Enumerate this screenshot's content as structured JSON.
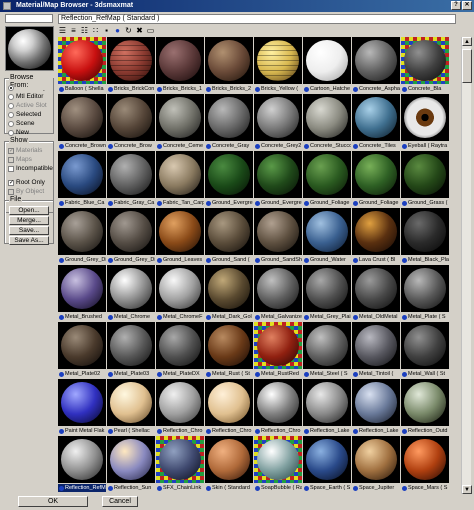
{
  "window": {
    "title": "Material/Map Browser - 3dsmaxmat"
  },
  "header": {
    "current": "Reflection_RefMap ( Standard )"
  },
  "toolbar": {
    "icons": [
      "list-icon",
      "list-small-icon",
      "list-large-icon",
      "small-icons-icon",
      "large-icons-icon",
      "globe-icon",
      "update-scene-icon",
      "delete-icon",
      "clear-icon"
    ]
  },
  "browse_from": {
    "title": "Browse From:",
    "options": [
      {
        "label": "Mtl Library",
        "selected": true,
        "enabled": true
      },
      {
        "label": "Mtl Editor",
        "selected": false,
        "enabled": true
      },
      {
        "label": "Active Slot",
        "selected": false,
        "enabled": false
      },
      {
        "label": "Selected",
        "selected": false,
        "enabled": true
      },
      {
        "label": "Scene",
        "selected": false,
        "enabled": true
      },
      {
        "label": "New",
        "selected": false,
        "enabled": true
      }
    ]
  },
  "show": {
    "title": "Show",
    "options": [
      {
        "label": "Materials",
        "checked": true,
        "enabled": false
      },
      {
        "label": "Maps",
        "checked": false,
        "enabled": false
      },
      {
        "label": "Incompatible",
        "checked": false,
        "enabled": true
      }
    ],
    "root_only": "Root Only",
    "by_object": "By Object"
  },
  "file": {
    "title": "File",
    "buttons": [
      "Open...",
      "Merge...",
      "Save...",
      "Save As..."
    ]
  },
  "footer": {
    "ok": "OK",
    "cancel": "Cancel"
  },
  "materials": [
    {
      "label": "Balloon  ( Shella",
      "colors": [
        "#ff6a5a",
        "#c81010",
        "#300000"
      ],
      "special": "check",
      "selected": false
    },
    {
      "label": "Bricks_BrickCon",
      "colors": [
        "#d07060",
        "#8a3a30",
        "#2a0c08"
      ],
      "special": "bricks",
      "selected": false
    },
    {
      "label": "Bricks_Bricks_1",
      "colors": [
        "#9a7070",
        "#5a3838",
        "#150808"
      ],
      "special": "",
      "selected": false
    },
    {
      "label": "Bricks_Bricks_2",
      "colors": [
        "#b09070",
        "#6a4a38",
        "#1a1008"
      ],
      "special": "",
      "selected": false
    },
    {
      "label": "Bricks_Yellow  (",
      "colors": [
        "#fff0a0",
        "#d8b850",
        "#4a3010"
      ],
      "special": "bricks",
      "selected": false
    },
    {
      "label": "Cartoon_Hatche",
      "colors": [
        "#ffffff",
        "#eeeeee",
        "#9a9a9a"
      ],
      "special": "",
      "selected": false
    },
    {
      "label": "Concrete_Aspha",
      "colors": [
        "#b8b8b8",
        "#606060",
        "#151515"
      ],
      "special": "",
      "selected": false
    },
    {
      "label": "Concrete_Bla",
      "colors": [
        "#909090",
        "#404040",
        "#080808"
      ],
      "special": "check",
      "selected": false
    },
    {
      "label": "Concrete_Brown",
      "colors": [
        "#a09080",
        "#5a4a40",
        "#100c08"
      ],
      "special": "",
      "selected": false
    },
    {
      "label": "Concrete_Brow",
      "colors": [
        "#9a8a78",
        "#554538",
        "#100c08"
      ],
      "special": "",
      "selected": false
    },
    {
      "label": "Concrete_Ceme",
      "colors": [
        "#c0c0b8",
        "#707068",
        "#181818"
      ],
      "special": "",
      "selected": false
    },
    {
      "label": "Concrete_Gray",
      "colors": [
        "#b8b8b8",
        "#686868",
        "#151515"
      ],
      "special": "",
      "selected": false
    },
    {
      "label": "Concrete_Grey2",
      "colors": [
        "#d0d0d0",
        "#787878",
        "#181818"
      ],
      "special": "",
      "selected": false
    },
    {
      "label": "Concrete_Stucco",
      "colors": [
        "#d8d8d0",
        "#8a8a80",
        "#1a1a18"
      ],
      "special": "",
      "selected": false
    },
    {
      "label": "Concrete_Tiles",
      "colors": [
        "#a8d0e8",
        "#407090",
        "#081520"
      ],
      "special": "",
      "selected": false
    },
    {
      "label": "Eyeball  ( Raytra",
      "colors": [
        "#e8e8e8",
        "#8a5a30",
        "#180c04"
      ],
      "special": "eye",
      "selected": false
    },
    {
      "label": "Fabric_Blue_Ca",
      "colors": [
        "#7a9ad0",
        "#2a4a80",
        "#050a18"
      ],
      "special": "",
      "selected": false
    },
    {
      "label": "Fabric_Gray_Ca",
      "colors": [
        "#b0b0b0",
        "#606060",
        "#101010"
      ],
      "special": "",
      "selected": false
    },
    {
      "label": "Fabric_Tan_Carp",
      "colors": [
        "#d8c8b0",
        "#8a7a60",
        "#181410"
      ],
      "special": "",
      "selected": false
    },
    {
      "label": "Ground_Evergre",
      "colors": [
        "#4a8a40",
        "#1a4a18",
        "#050e04"
      ],
      "special": "",
      "selected": false
    },
    {
      "label": "Ground_Evergre",
      "colors": [
        "#5a9a48",
        "#204a1a",
        "#050e04"
      ],
      "special": "",
      "selected": false
    },
    {
      "label": "Ground_Foliage",
      "colors": [
        "#6aa050",
        "#2a5a20",
        "#081405"
      ],
      "special": "",
      "selected": false
    },
    {
      "label": "Ground_Foliage",
      "colors": [
        "#78b058",
        "#2e6024",
        "#081405"
      ],
      "special": "",
      "selected": false
    },
    {
      "label": "Ground_Grass  (",
      "colors": [
        "#5a8a40",
        "#244818",
        "#060e04"
      ],
      "special": "",
      "selected": false
    },
    {
      "label": "Ground_Grey_Di",
      "colors": [
        "#a8a098",
        "#5a5248",
        "#100e0c"
      ],
      "special": "",
      "selected": false
    },
    {
      "label": "Ground_Grey_Di",
      "colors": [
        "#a09890",
        "#544c44",
        "#100e0c"
      ],
      "special": "",
      "selected": false
    },
    {
      "label": "Ground_Leaves",
      "colors": [
        "#e0a060",
        "#8a4a18",
        "#1a0c04"
      ],
      "special": "",
      "selected": false
    },
    {
      "label": "Ground_Sand  (",
      "colors": [
        "#a89880",
        "#5a4c3a",
        "#100c08"
      ],
      "special": "",
      "selected": false
    },
    {
      "label": "Ground_SandSh",
      "colors": [
        "#b0a090",
        "#5e5040",
        "#100c08"
      ],
      "special": "",
      "selected": false
    },
    {
      "label": "Ground_Water",
      "colors": [
        "#a0c0e0",
        "#3a6090",
        "#081428"
      ],
      "special": "",
      "selected": false
    },
    {
      "label": "Lava Crust  ( Bl",
      "colors": [
        "#e0a040",
        "#5a3010",
        "#100604"
      ],
      "special": "",
      "selected": false
    },
    {
      "label": "Metal_Black_Pla",
      "colors": [
        "#6a6a6a",
        "#2a2a2a",
        "#050505"
      ],
      "special": "",
      "selected": false
    },
    {
      "label": "Metal_Brushed",
      "colors": [
        "#c8c0e0",
        "#5a4a8a",
        "#0c0818"
      ],
      "special": "",
      "selected": false
    },
    {
      "label": "Metal_Chrome",
      "colors": [
        "#ffffff",
        "#909090",
        "#202020"
      ],
      "special": "",
      "selected": false
    },
    {
      "label": "Metal_ChromeF",
      "colors": [
        "#f8f8f8",
        "#a0a0a0",
        "#282828"
      ],
      "special": "",
      "selected": false
    },
    {
      "label": "Metal_Dark_Gol",
      "colors": [
        "#c0a878",
        "#5a4a30",
        "#100c06"
      ],
      "special": "",
      "selected": false
    },
    {
      "label": "Metal_Galvanize",
      "colors": [
        "#c0c0c0",
        "#606060",
        "#101010"
      ],
      "special": "",
      "selected": false
    },
    {
      "label": "Metal_Grey_Plai",
      "colors": [
        "#a8a8a8",
        "#505050",
        "#0a0a0a"
      ],
      "special": "",
      "selected": false
    },
    {
      "label": "Metal_OldMetal",
      "colors": [
        "#9a9a9a",
        "#484848",
        "#0a0a0a"
      ],
      "special": "",
      "selected": false
    },
    {
      "label": "Metal_Plate  ( S",
      "colors": [
        "#b8b8b8",
        "#585858",
        "#0c0c0c"
      ],
      "special": "",
      "selected": false
    },
    {
      "label": "Metal_Plate02",
      "colors": [
        "#9a8a78",
        "#4a3a2c",
        "#0c0806"
      ],
      "special": "",
      "selected": false
    },
    {
      "label": "Metal_Plate03",
      "colors": [
        "#b0b0b0",
        "#585858",
        "#0c0c0c"
      ],
      "special": "",
      "selected": false
    },
    {
      "label": "Metal_PlateDX",
      "colors": [
        "#a8a8a8",
        "#505050",
        "#0a0a0a"
      ],
      "special": "",
      "selected": false
    },
    {
      "label": "Metal_Rust  ( St",
      "colors": [
        "#b88a60",
        "#6a3a18",
        "#140804"
      ],
      "special": "",
      "selected": false
    },
    {
      "label": "Metal_RustRed",
      "colors": [
        "#e08060",
        "#902010",
        "#200404"
      ],
      "special": "check",
      "selected": false
    },
    {
      "label": "Metal_Steel  ( S",
      "colors": [
        "#c0c0c0",
        "#606060",
        "#101010"
      ],
      "special": "",
      "selected": false
    },
    {
      "label": "Metal_Tintoil  (",
      "colors": [
        "#b8b8c0",
        "#585860",
        "#0c0c0e"
      ],
      "special": "",
      "selected": false
    },
    {
      "label": "Metal_Wall  ( St",
      "colors": [
        "#909090",
        "#404040",
        "#080808"
      ],
      "special": "",
      "selected": false
    },
    {
      "label": "Paint Metal Flak",
      "colors": [
        "#a0a8ff",
        "#3030c0",
        "#050520"
      ],
      "special": "",
      "selected": false
    },
    {
      "label": "Pearl  ( Shellac",
      "colors": [
        "#fff8e0",
        "#e0c090",
        "#5a4020"
      ],
      "special": "",
      "selected": false
    },
    {
      "label": "Reflection_Chro",
      "colors": [
        "#f0f0f0",
        "#a0a0a0",
        "#303030"
      ],
      "special": "",
      "selected": false
    },
    {
      "label": "Reflection_Chro",
      "colors": [
        "#fff0d8",
        "#e0c090",
        "#6a4a20"
      ],
      "special": "",
      "selected": false
    },
    {
      "label": "Reflection_Chro",
      "colors": [
        "#ffffff",
        "#808080",
        "#181818"
      ],
      "special": "",
      "selected": false
    },
    {
      "label": "Reflection_Lake",
      "colors": [
        "#e8e8e8",
        "#8a8a8a",
        "#181818"
      ],
      "special": "",
      "selected": false
    },
    {
      "label": "Reflection_Lake",
      "colors": [
        "#d8e0f0",
        "#6a7a9a",
        "#101420"
      ],
      "special": "",
      "selected": false
    },
    {
      "label": "Reflection_Outd",
      "colors": [
        "#e0e8d8",
        "#7a8a6a",
        "#101408"
      ],
      "special": "",
      "selected": false
    },
    {
      "label": "Reflection_RefM",
      "colors": [
        "#f0f0f0",
        "#909090",
        "#202020"
      ],
      "special": "",
      "selected": true
    },
    {
      "label": "Reflection_Sun",
      "colors": [
        "#ffe8c0",
        "#8a8ac0",
        "#202040"
      ],
      "special": "",
      "selected": false
    },
    {
      "label": "SFX_ChainLink",
      "colors": [
        "#90a0c0",
        "#404a70",
        "#080a18"
      ],
      "special": "check",
      "selected": false
    },
    {
      "label": "Skin  ( Standard",
      "colors": [
        "#f0b080",
        "#b06a3a",
        "#2a1005"
      ],
      "special": "",
      "selected": false
    },
    {
      "label": "SoapBubble  ( Ra",
      "colors": [
        "#ffffff",
        "#80a0a0",
        "#204040"
      ],
      "special": "check",
      "selected": false
    },
    {
      "label": "Space_Earth  ( S",
      "colors": [
        "#8ab0e0",
        "#2a4a8a",
        "#050a18"
      ],
      "special": "",
      "selected": false
    },
    {
      "label": "Space_Jupiter",
      "colors": [
        "#f0d0a0",
        "#a07040",
        "#201005"
      ],
      "special": "",
      "selected": false
    },
    {
      "label": "Space_Mars  ( S",
      "colors": [
        "#ff9a60",
        "#b04010",
        "#200804"
      ],
      "special": "",
      "selected": false
    }
  ]
}
